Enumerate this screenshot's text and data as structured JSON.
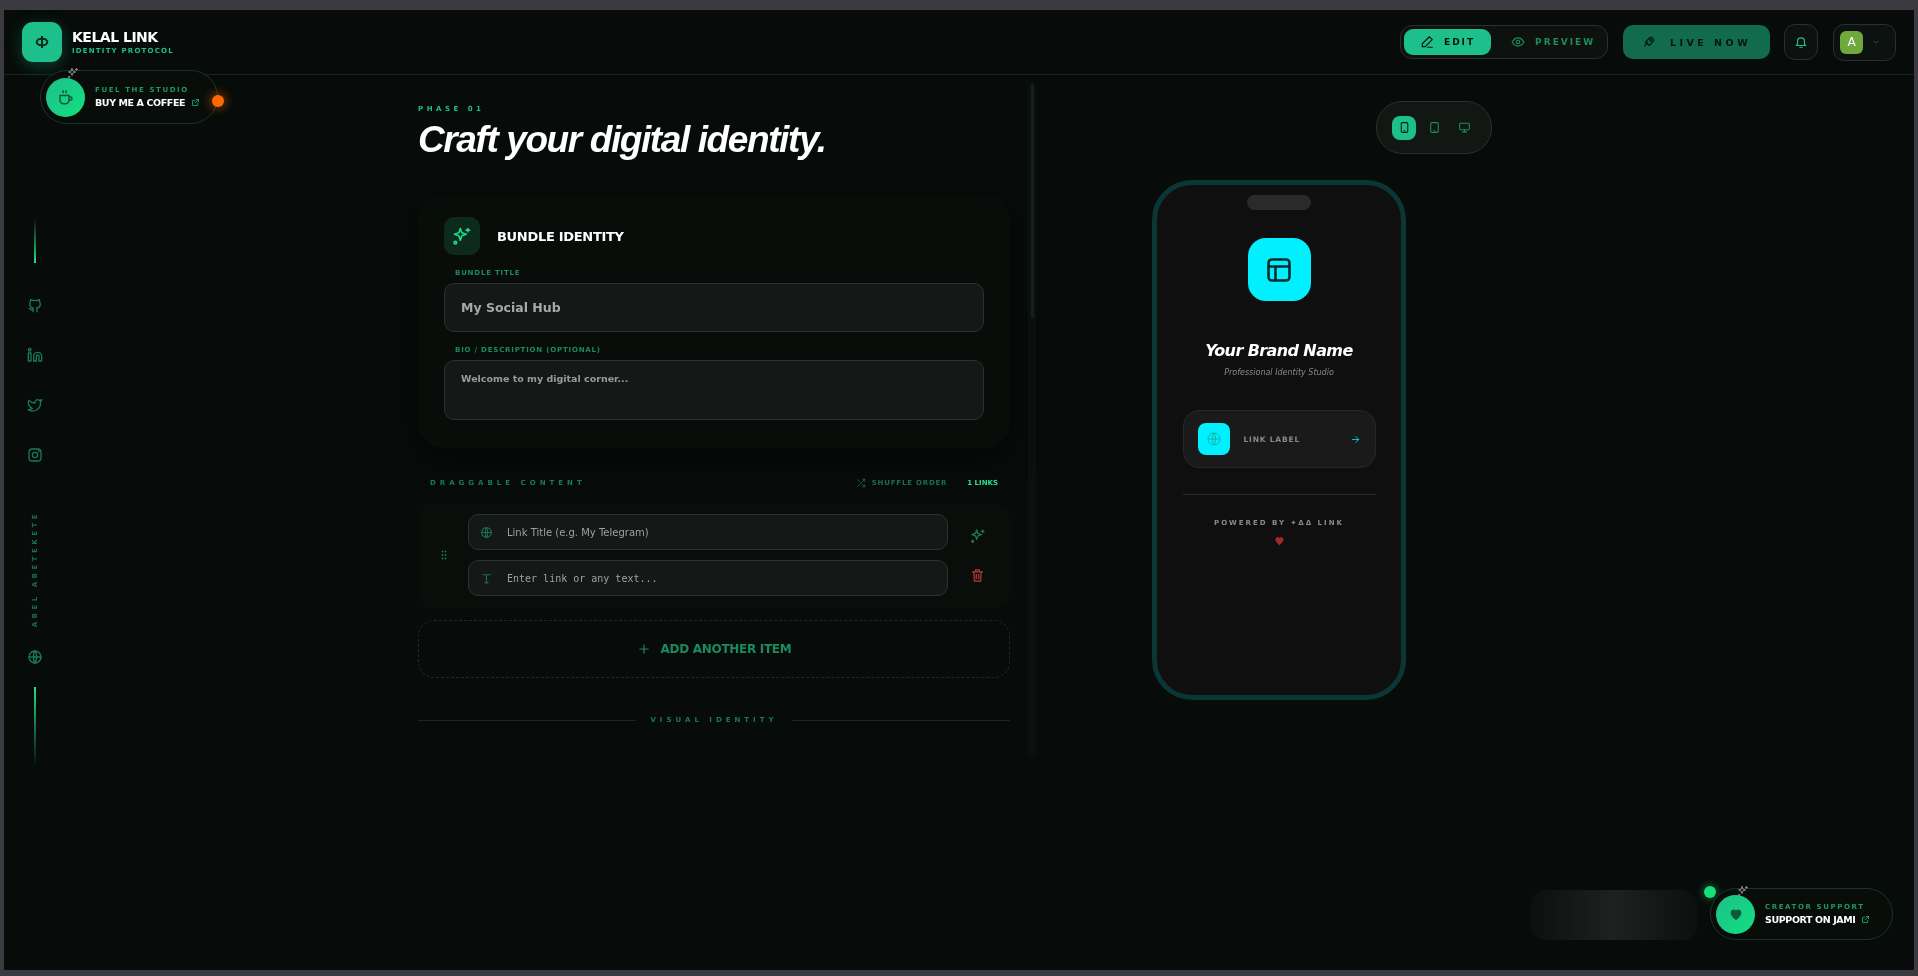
{
  "header": {
    "brand": {
      "title": "KELAL LINK",
      "subtitle": "IDENTITY PROTOCOL"
    },
    "mode_tabs": [
      {
        "label": "EDIT",
        "kind": "edit",
        "selected": true
      },
      {
        "label": "PREVIEW",
        "kind": "preview",
        "selected": false
      }
    ],
    "live_button": "LIVE NOW",
    "avatar": {
      "initial": "A"
    }
  },
  "coffee_widget": {
    "eyebrow": "FUEL THE STUDIO",
    "label": "BUY ME A COFFEE"
  },
  "sidebar": {
    "author": "ABEL ABETEKETE"
  },
  "editor": {
    "phase": "PHASE 01",
    "heading": "Craft your digital identity.",
    "bundle": {
      "title": "BUNDLE IDENTITY",
      "fields": [
        {
          "label": "BUNDLE TITLE",
          "kind": "input",
          "value": "My Social Hub"
        },
        {
          "label": "BIO / DESCRIPTION (OPTIONAL)",
          "kind": "textarea",
          "placeholder": "Welcome to my digital corner..."
        }
      ]
    },
    "content": {
      "title": "DRAGGABLE CONTENT",
      "shuffle": "SHUFFLE ORDER",
      "count": "1 LINKS",
      "items": [
        {
          "title_placeholder": "Link Title (e.g. My Telegram)",
          "value_placeholder": "Enter link or any text..."
        }
      ]
    },
    "add_button": "ADD ANOTHER ITEM",
    "section_divider": "VISUAL IDENTITY"
  },
  "device_tabs": [
    {
      "kind": "phone",
      "selected": true
    },
    {
      "kind": "tablet",
      "selected": false
    },
    {
      "kind": "desktop",
      "selected": false
    }
  ],
  "preview": {
    "brand_name": "Your Brand Name",
    "tagline": "Professional Identity Studio",
    "links": [
      {
        "label": "LINK LABEL"
      }
    ],
    "powered_by": "POWERED BY ✦ΔΔ LINK"
  },
  "support_widget": {
    "eyebrow": "CREATOR SUPPORT",
    "label": "SUPPORT ON JAMI"
  }
}
